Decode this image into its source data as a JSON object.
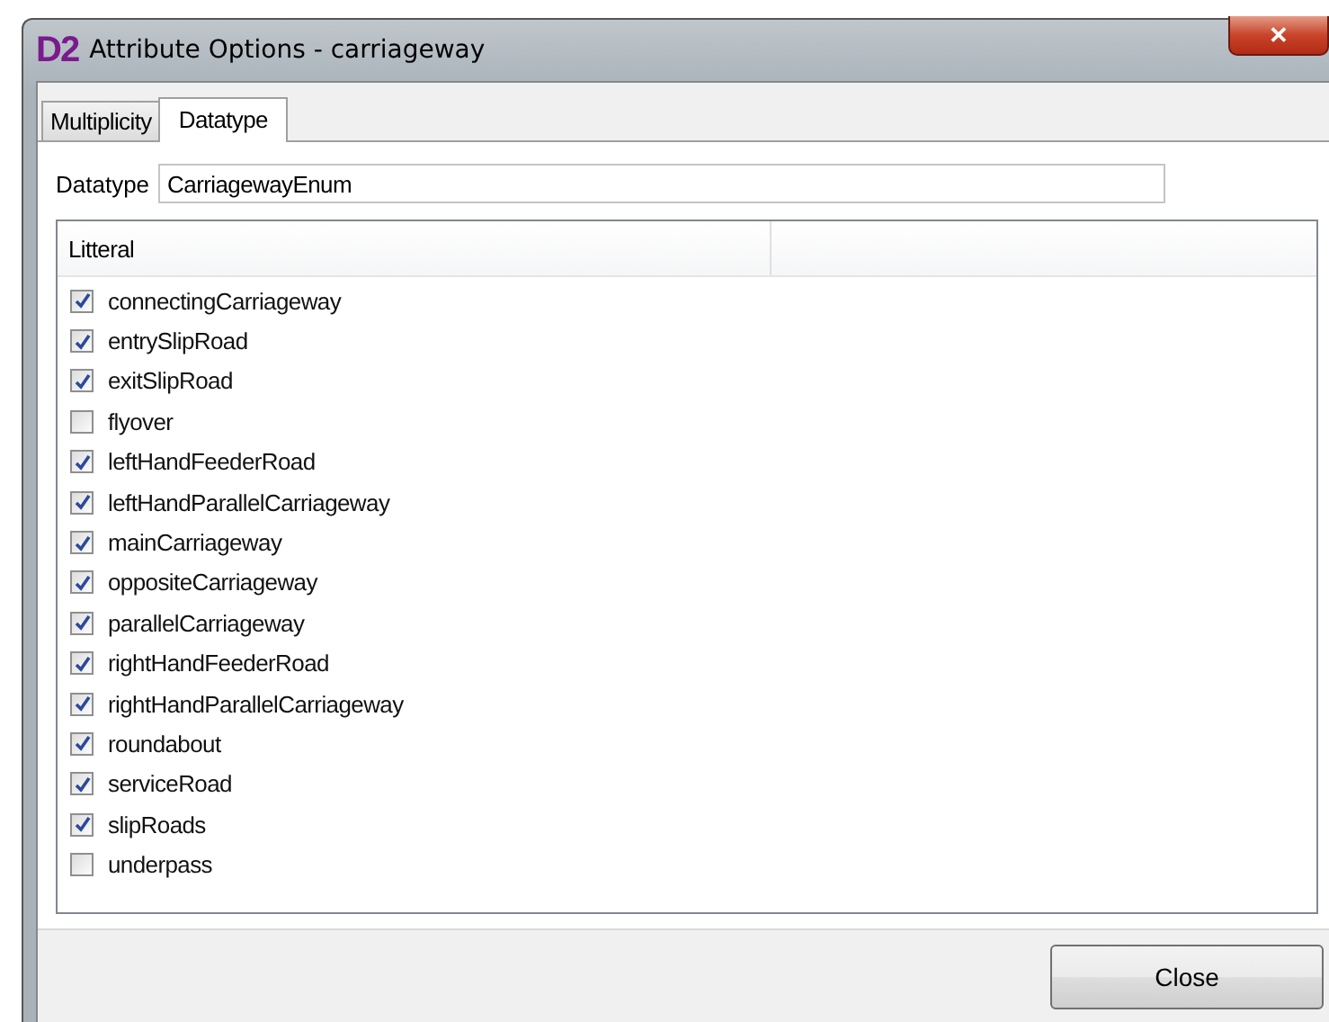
{
  "window": {
    "logo": "D2",
    "title": "Attribute Options - carriageway",
    "close_symbol": "✕"
  },
  "tabs": [
    {
      "label": "Multiplicity",
      "selected": false
    },
    {
      "label": "Datatype",
      "selected": true
    }
  ],
  "datatype": {
    "label": "Datatype",
    "value": "CarriagewayEnum"
  },
  "table": {
    "columns": [
      "Litteral"
    ],
    "rows": [
      {
        "label": "connectingCarriageway",
        "checked": true
      },
      {
        "label": "entrySlipRoad",
        "checked": true
      },
      {
        "label": "exitSlipRoad",
        "checked": true
      },
      {
        "label": "flyover",
        "checked": false
      },
      {
        "label": "leftHandFeederRoad",
        "checked": true
      },
      {
        "label": "leftHandParallelCarriageway",
        "checked": true
      },
      {
        "label": "mainCarriageway",
        "checked": true
      },
      {
        "label": "oppositeCarriageway",
        "checked": true
      },
      {
        "label": "parallelCarriageway",
        "checked": true
      },
      {
        "label": "rightHandFeederRoad",
        "checked": true
      },
      {
        "label": "rightHandParallelCarriageway",
        "checked": true
      },
      {
        "label": "roundabout",
        "checked": true
      },
      {
        "label": "serviceRoad",
        "checked": true
      },
      {
        "label": "slipRoads",
        "checked": true
      },
      {
        "label": "underpass",
        "checked": false
      }
    ]
  },
  "buttons": [
    "Close"
  ]
}
